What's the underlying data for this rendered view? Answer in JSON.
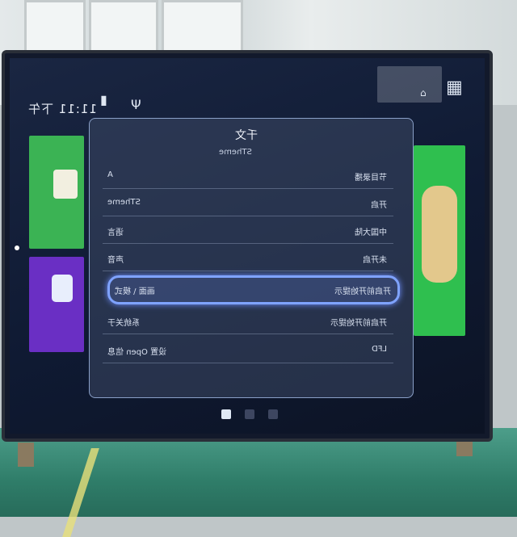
{
  "status_bar": {
    "clock": "11:11 下午"
  },
  "settings": {
    "title": "千文",
    "subtitle": "STheme",
    "rows": [
      {
        "label": "A",
        "value": "节目录播"
      },
      {
        "label": "STheme",
        "value": "开启"
      },
      {
        "label": "语言",
        "value": "中国大陆"
      },
      {
        "label": "声音",
        "value": "未开启"
      },
      {
        "label": "画面 \\ 模式",
        "value": "开启前开始提示"
      },
      {
        "label": "系统关于",
        "value": "开启前开始提示"
      },
      {
        "label": "设置 Open 信息",
        "value": "LFD"
      }
    ],
    "selected_index": 4
  },
  "page_dots": {
    "count": 3,
    "active": 0
  },
  "colors": {
    "highlight": "#7fa3ff",
    "panel": "#3c4864",
    "screen": "#0f1a33"
  },
  "icons": [
    "battery-icon",
    "antenna-icon",
    "grid-icon",
    "home-icon"
  ]
}
